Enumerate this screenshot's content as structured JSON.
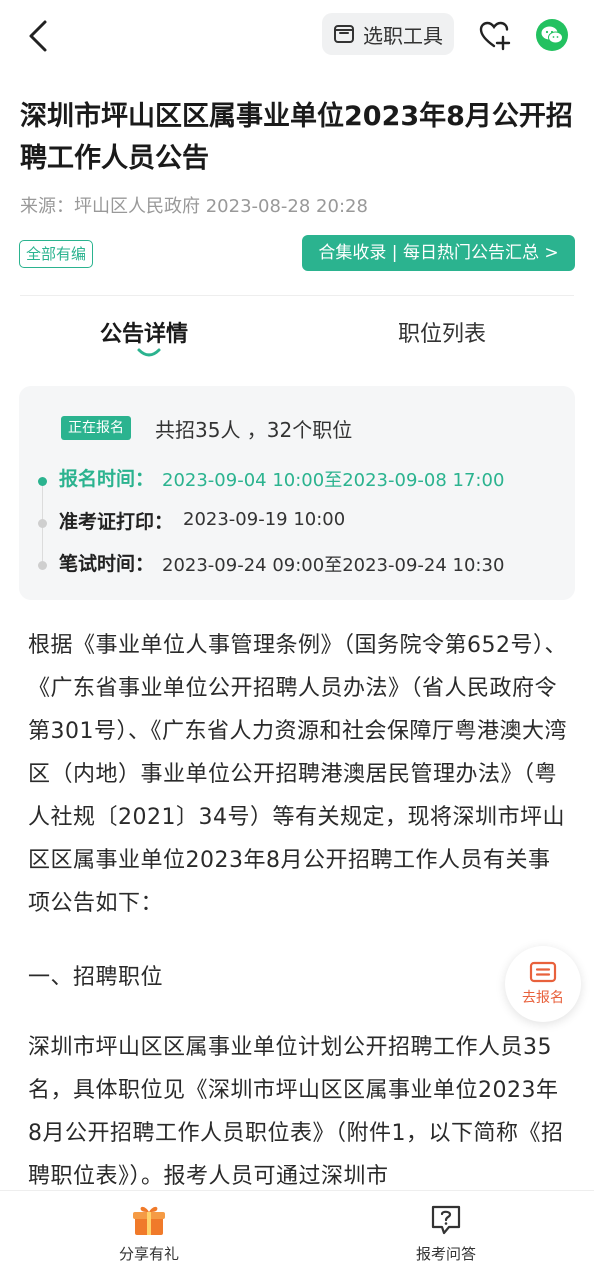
{
  "header": {
    "tool_label": "选职工具",
    "icons": {
      "back": "chevron-left-icon",
      "tool": "briefcase-icon",
      "favorite": "heart-plus-icon",
      "share": "wechat-icon"
    }
  },
  "article": {
    "title": "深圳市坪山区区属事业单位2023年8月公开招聘工作人员公告",
    "source": "来源：坪山区人民政府  2023-08-28 20:28",
    "tag": "全部有编",
    "collection_label": "合集收录 | 每日热门公告汇总 >"
  },
  "tabs": [
    {
      "label": "公告详情",
      "active": true
    },
    {
      "label": "职位列表",
      "active": false
    }
  ],
  "info": {
    "status": "正在报名",
    "summary": "共招35人 ，32个职位",
    "timeline": [
      {
        "label": "报名时间：",
        "value": "2023-09-04 10:00至2023-09-08 17:00",
        "active": true
      },
      {
        "label": "准考证打印：",
        "value": "2023-09-19 10:00",
        "active": false
      },
      {
        "label": "笔试时间：",
        "value": "2023-09-24 09:00至2023-09-24 10:30",
        "active": false
      }
    ]
  },
  "content": {
    "p1": "根据《事业单位人事管理条例》（国务院令第652号）、《广东省事业单位公开招聘人员办法》（省人民政府令第301号）、《广东省人力资源和社会保障厅粤港澳大湾区（内地）事业单位公开招聘港澳居民管理办法》（粤人社规〔2021〕34号）等有关规定，现将深圳市坪山区区属事业单位2023年8月公开招聘工作人员有关事项公告如下：",
    "p2": "一、招聘职位",
    "p3": "深圳市坪山区区属事业单位计划公开招聘工作人员35名，具体职位见《深圳市坪山区区属事业单位2023年8月公开招聘工作人员职位表》（附件1，以下简称《招聘职位表》）。报考人员可通过深圳市"
  },
  "float_button": {
    "label": "去报名",
    "icon": "register-list-icon"
  },
  "bottom_bar": [
    {
      "label": "分享有礼",
      "icon": "gift-icon"
    },
    {
      "label": "报考问答",
      "icon": "question-bubble-icon"
    }
  ],
  "colors": {
    "accent": "#2bb38f",
    "register": "#e8613c",
    "gift": "#f07a2a"
  }
}
